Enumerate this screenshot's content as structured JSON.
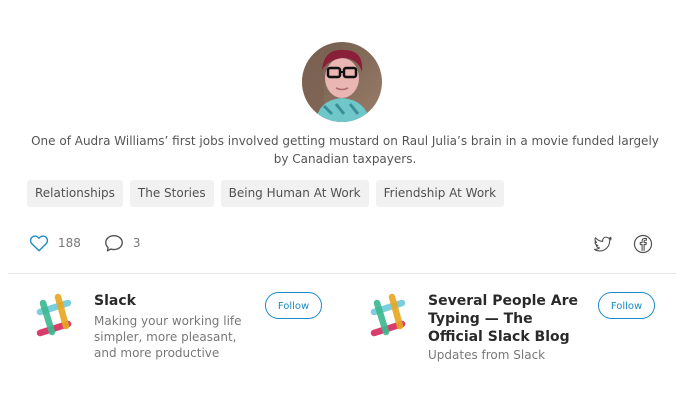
{
  "author": {
    "avatar_icon": "author-avatar-photo",
    "bio": "One of Audra Williams’ first jobs involved getting mustard on Raul Julia’s brain in a movie funded largely by Canadian taxpayers."
  },
  "tags": [
    "Relationships",
    "The Stories",
    "Being Human At Work",
    "Friendship At Work"
  ],
  "actions": {
    "claps_icon": "heart-icon",
    "claps_count": "188",
    "responses_icon": "comment-icon",
    "responses_count": "3",
    "share": [
      {
        "name": "twitter-icon"
      },
      {
        "name": "facebook-icon"
      }
    ]
  },
  "cards": [
    {
      "logo": "slack-logo-icon",
      "name": "Slack",
      "description": "Making your working life simpler, more pleasant, and more productive",
      "follow_label": "Follow"
    },
    {
      "logo": "slack-logo-icon",
      "name": "Several People Are Typing — The Official Slack Blog",
      "description": "Updates from Slack",
      "follow_label": "Follow"
    }
  ],
  "colors": {
    "accent": "#1a8bc9",
    "tag_bg": "#f1f1f1",
    "slack_blue": "#70cadb",
    "slack_yellow": "#e8a723",
    "slack_red": "#d72b60",
    "slack_green": "#3eb890"
  }
}
